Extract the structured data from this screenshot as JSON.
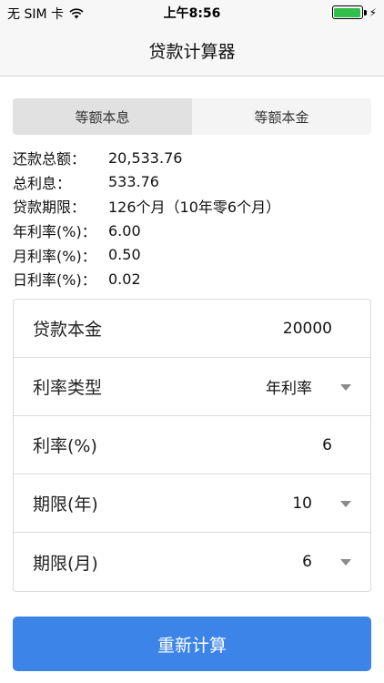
{
  "status_bar": {
    "carrier": "无 SIM 卡",
    "time": "上午8:56",
    "battery_level": 1.0,
    "battery_color": "#2fbf4a",
    "icons": [
      "wifi-icon",
      "battery-icon",
      "charging-bolt-icon"
    ]
  },
  "nav": {
    "title": "贷款计算器"
  },
  "tabs": [
    {
      "label": "等额本息",
      "active": true
    },
    {
      "label": "等额本金",
      "active": false
    }
  ],
  "results": [
    {
      "label": "还款总额：",
      "value": "20,533.76"
    },
    {
      "label": "总利息：",
      "value": "533.76"
    },
    {
      "label": "贷款期限：",
      "value": "126个月（10年零6个月）"
    },
    {
      "label": "年利率(%)：",
      "value": "6.00"
    },
    {
      "label": "月利率(%)：",
      "value": "0.50"
    },
    {
      "label": "日利率(%)：",
      "value": "0.02"
    }
  ],
  "form": {
    "principal": {
      "label": "贷款本金",
      "value": "20000"
    },
    "rate_type": {
      "label": "利率类型",
      "value": "年利率",
      "icon": "chevron-down-icon"
    },
    "rate": {
      "label": "利率(%)",
      "value": "6"
    },
    "term_years": {
      "label": "期限(年)",
      "value": "10",
      "icon": "chevron-down-icon"
    },
    "term_months": {
      "label": "期限(月)",
      "value": "6",
      "icon": "chevron-down-icon"
    }
  },
  "button": {
    "label": "重新计算",
    "color": "#3d84e9"
  }
}
